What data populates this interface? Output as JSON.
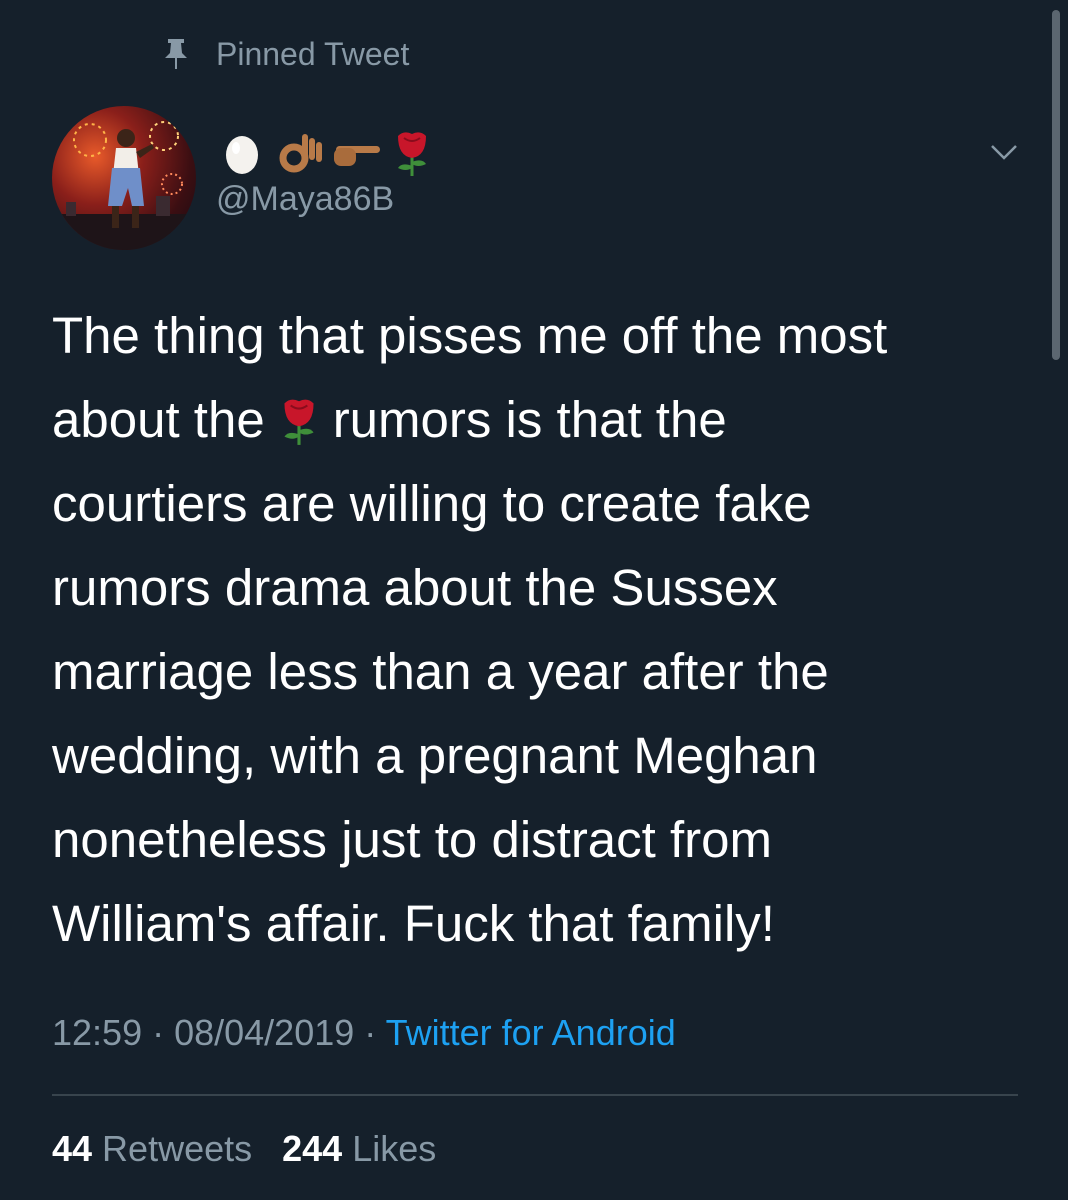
{
  "pinned": {
    "label": "Pinned Tweet",
    "icon": "pin-icon"
  },
  "author": {
    "display_name_icons": [
      "egg-emoji-icon",
      "ok-hand-emoji-icon",
      "pointing-right-emoji-icon",
      "rose-emoji-icon"
    ],
    "handle": "@Maya86B",
    "avatar_icon": "avatar"
  },
  "tweet": {
    "lines": [
      "The thing that pisses me off the most",
      "about the",
      "rumors is that the",
      "courtiers are willing to create fake",
      "rumors drama about the Sussex",
      "marriage less than a year after the",
      "wedding, with a pregnant Meghan",
      "nonetheless just to distract from",
      "William's affair. Fuck that family!"
    ],
    "inline_icon": "rose-emoji-icon"
  },
  "meta": {
    "time": "12:59",
    "separator": " · ",
    "date": "08/04/2019",
    "source": "Twitter for Android"
  },
  "stats": {
    "retweets_count": "44",
    "retweets_label": " Retweets",
    "likes_count": "244",
    "likes_label": " Likes"
  },
  "colors": {
    "background": "#15202b",
    "secondary_text": "#8899a6",
    "link": "#1da1f2",
    "divider": "#38444d"
  }
}
